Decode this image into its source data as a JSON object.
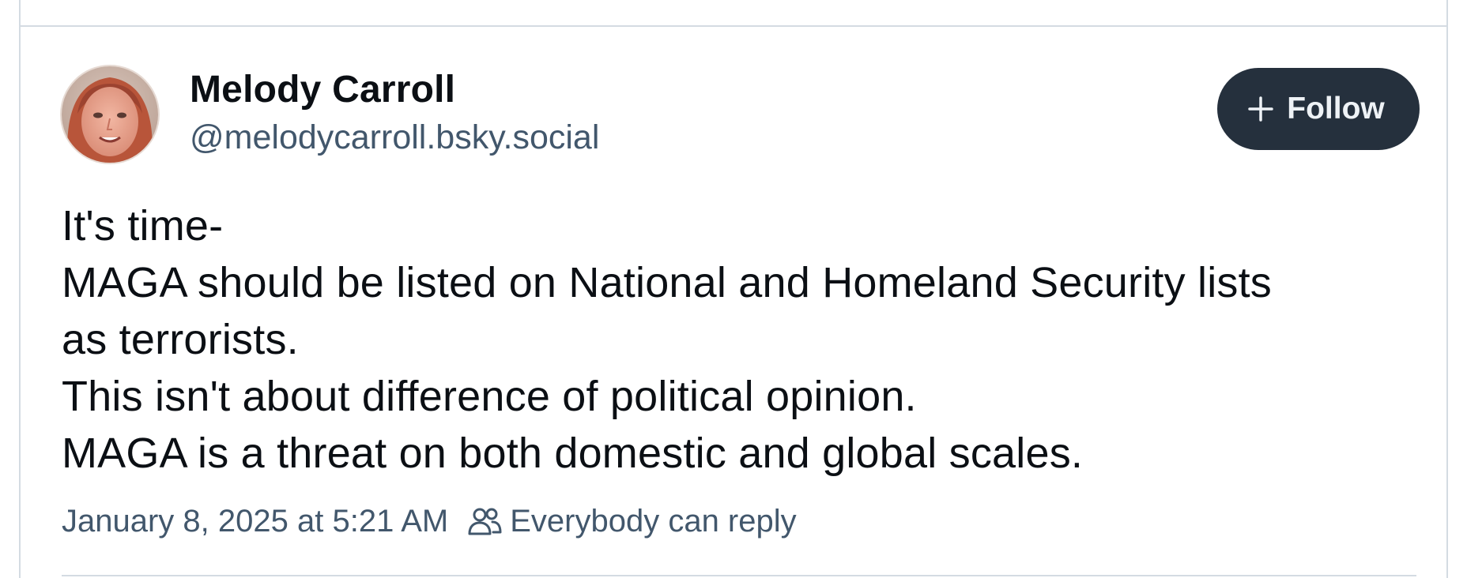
{
  "post": {
    "author": {
      "display_name": "Melody Carroll",
      "handle": "@melodycarroll.bsky.social",
      "avatar_icon": "profile-photo"
    },
    "follow_button": {
      "label": "Follow",
      "icon": "plus-icon"
    },
    "text_lines": [
      "It's time-",
      "MAGA should be listed on National and Homeland Security lists",
      "as terrorists.",
      "This isn't about difference of political opinion.",
      "MAGA is a threat on both domestic and global scales."
    ],
    "timestamp": "January 8, 2025 at 5:21 AM",
    "reply_setting": {
      "label": "Everybody can reply",
      "icon": "people-icon"
    }
  },
  "colors": {
    "text_primary": "#0b0f14",
    "text_secondary": "#42576c",
    "follow_bg": "#25303d",
    "follow_text": "#eef2f6",
    "divider": "#d4dbe2"
  }
}
